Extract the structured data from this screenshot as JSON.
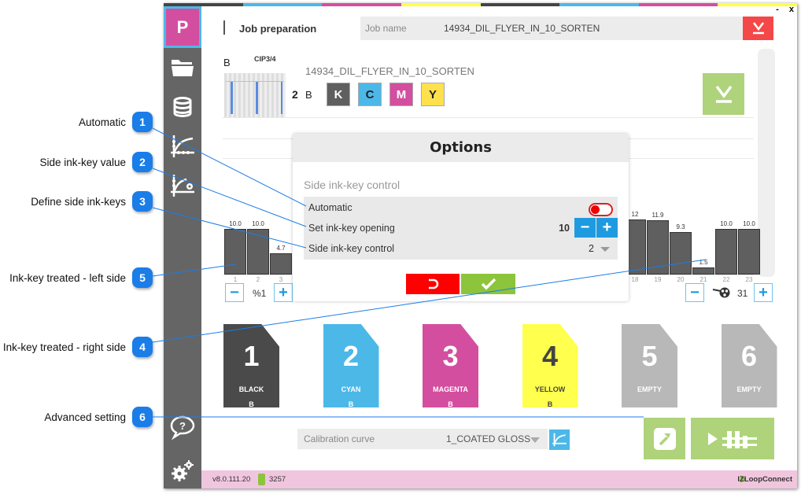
{
  "callouts": [
    {
      "num": "1",
      "label": "Automatic"
    },
    {
      "num": "2",
      "label": "Side ink-key value"
    },
    {
      "num": "3",
      "label": "Define side ink-keys"
    },
    {
      "num": "5",
      "label": "Ink-key treated - left side"
    },
    {
      "num": "4",
      "label": "Ink-key treated - right side"
    },
    {
      "num": "6",
      "label": "Advanced setting"
    }
  ],
  "window": {
    "minimize": "-",
    "close": "x"
  },
  "colors": {
    "black": "#4a4a4a",
    "cyan": "#4cb8e8",
    "magenta": "#d44e9f",
    "yellow": "#ffff4d",
    "empty": "#b8b8b8",
    "accent_green": "#aed37a",
    "accent_red": "#f44848",
    "footer": "#f0c6df"
  },
  "sidebar": {
    "logo": "P",
    "items": [
      {
        "icon": "folder-icon"
      },
      {
        "icon": "database-icon"
      },
      {
        "icon": "curve-icon"
      },
      {
        "icon": "curve-settings-icon"
      },
      {
        "icon": "help-icon"
      },
      {
        "icon": "settings-icon"
      }
    ]
  },
  "header": {
    "title": "Job preparation",
    "job_label": "Job name",
    "job_value": "14934_DIL_FLYER_IN_10_SORTEN"
  },
  "job": {
    "side": "B",
    "cip": "CIP3/4",
    "name": "14934_DIL_FLYER_IN_10_SORTEN",
    "plate_count": "2",
    "plate_side": "B",
    "inks": [
      "K",
      "C",
      "M",
      "Y"
    ]
  },
  "inkkeys": {
    "left": [
      {
        "key": "1",
        "value": "10.0",
        "v": 10.0
      },
      {
        "key": "2",
        "value": "10.0",
        "v": 10.0
      },
      {
        "key": "3",
        "value": "4.7",
        "v": 4.7
      }
    ],
    "right": [
      {
        "key": "18",
        "value": "12",
        "v": 12.2
      },
      {
        "key": "19",
        "value": "11.9",
        "v": 11.9
      },
      {
        "key": "20",
        "value": "9.3",
        "v": 9.3
      },
      {
        "key": "21",
        "value": "1.5",
        "v": 1.5
      },
      {
        "key": "22",
        "value": "10.0",
        "v": 10.0
      },
      {
        "key": "23",
        "value": "10.0",
        "v": 10.0
      }
    ],
    "left_zoom": "%1",
    "right_count": "31"
  },
  "units": [
    {
      "num": "1",
      "color": "BLACK",
      "side": "B",
      "bg": "#4a4a4a",
      "fg": "#ffffff"
    },
    {
      "num": "2",
      "color": "CYAN",
      "side": "B",
      "bg": "#4cb8e8",
      "fg": "#ffffff"
    },
    {
      "num": "3",
      "color": "MAGENTA",
      "side": "B",
      "bg": "#d44e9f",
      "fg": "#ffffff"
    },
    {
      "num": "4",
      "color": "YELLOW",
      "side": "B",
      "bg": "#ffff4d",
      "fg": "#444444"
    },
    {
      "num": "5",
      "color": "EMPTY",
      "side": "",
      "bg": "#b8b8b8",
      "fg": "#ffffff"
    },
    {
      "num": "6",
      "color": "EMPTY",
      "side": "",
      "bg": "#b8b8b8",
      "fg": "#ffffff"
    }
  ],
  "calibration": {
    "label": "Calibration curve",
    "value": "1_COATED GLOSS"
  },
  "footer": {
    "version": "v8.0.111.20",
    "id": "3257",
    "connect": "IZLoopConnect"
  },
  "dialog": {
    "title": "Options",
    "section": "Side ink-key control",
    "automatic_label": "Automatic",
    "automatic_on": false,
    "opening_label": "Set ink-key opening",
    "opening_value": "10",
    "control_label": "Side ink-key control",
    "control_value": "2"
  }
}
